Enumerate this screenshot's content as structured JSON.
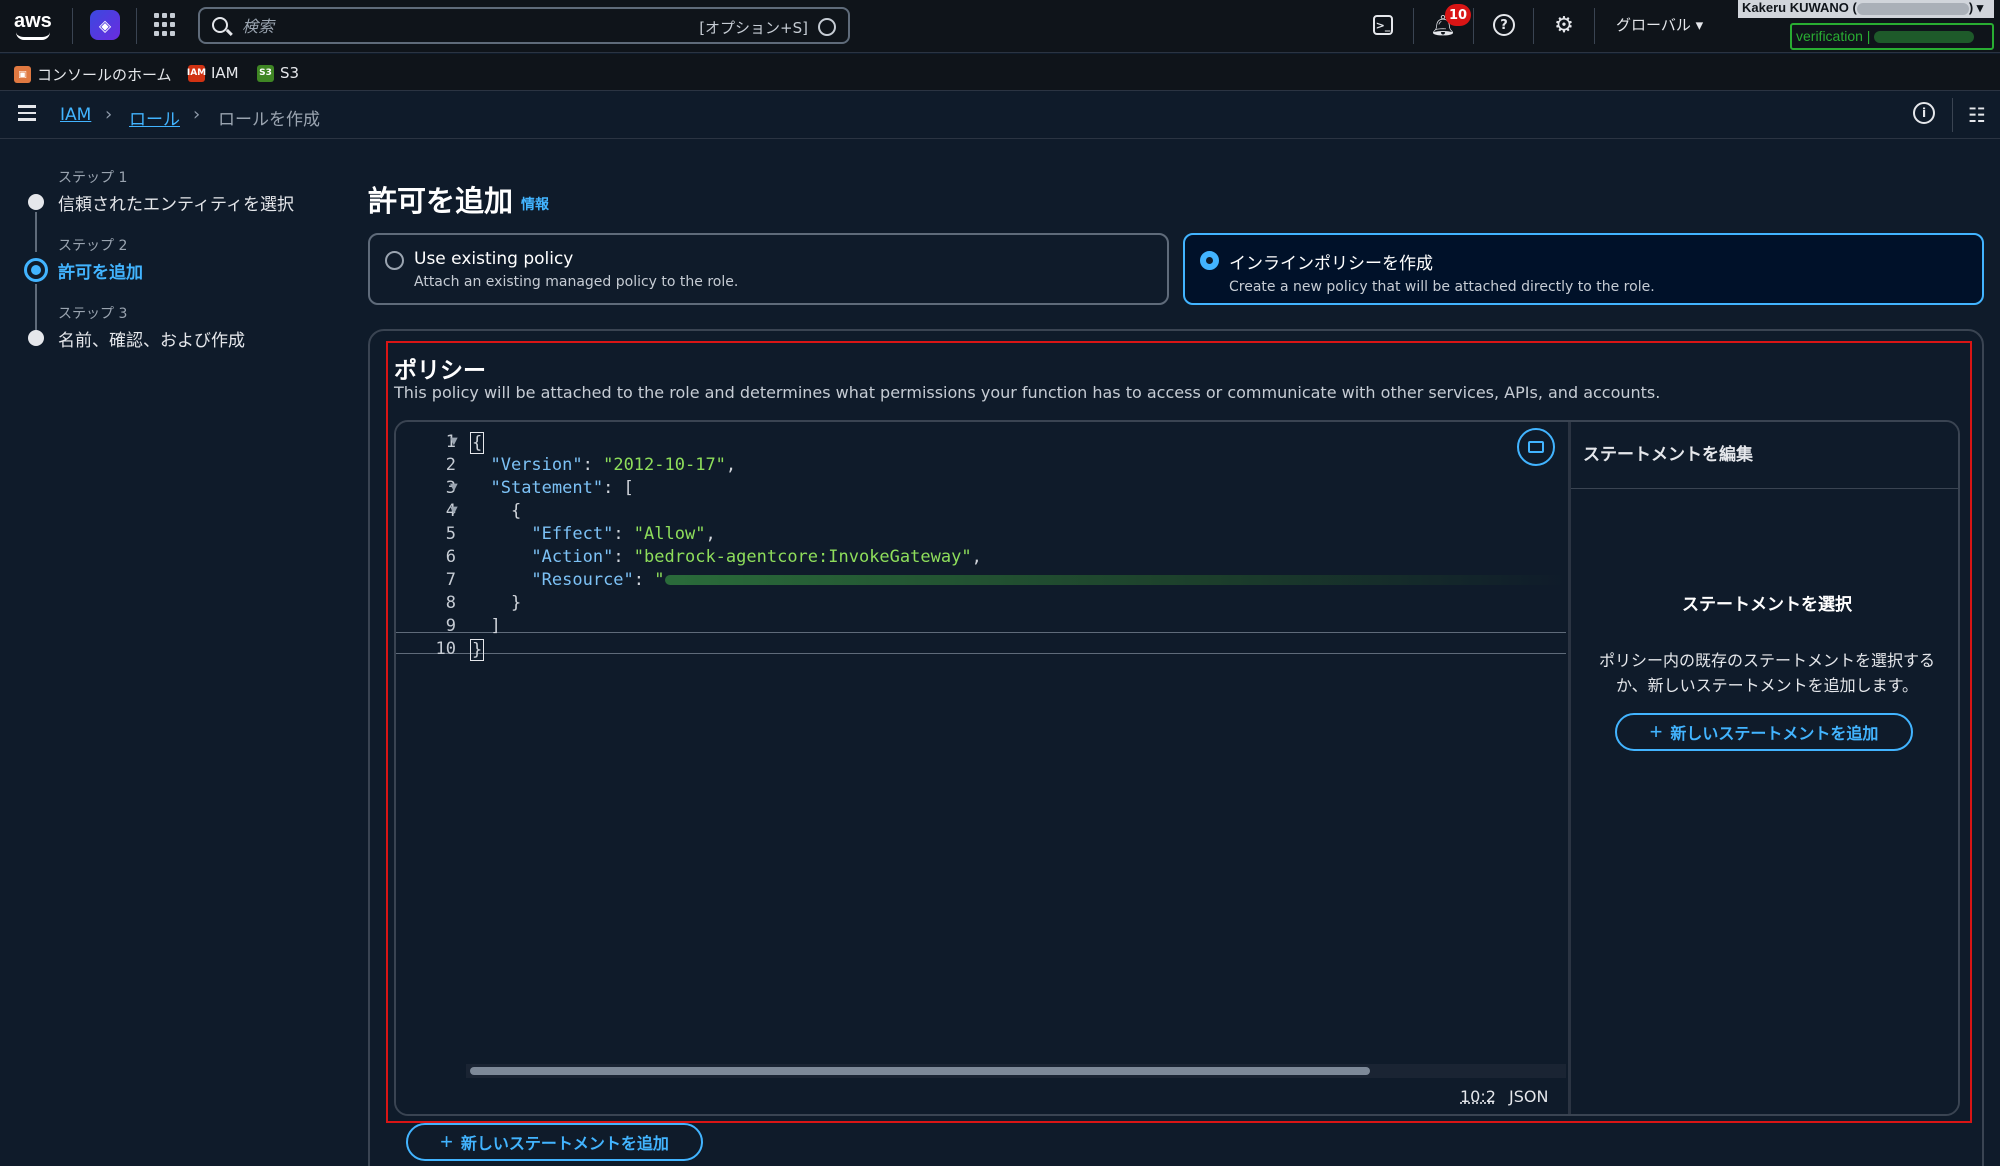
{
  "topnav": {
    "search_placeholder": "検索",
    "search_shortcut": "[オプション+S]",
    "notification_count": "10",
    "region": "グローバル ▾",
    "user": "Kakeru KUWANO (",
    "user_suffix": ") ▾",
    "verification": "verification |"
  },
  "favorites": [
    {
      "label": "コンソールのホーム",
      "color": "#e07941"
    },
    {
      "label": "IAM",
      "color": "#d13212"
    },
    {
      "label": "S3",
      "color": "#3f8624"
    }
  ],
  "breadcrumb": {
    "item1": "IAM",
    "item2": "ロール",
    "current": "ロールを作成"
  },
  "steps": [
    {
      "num": "ステップ 1",
      "title": "信頼されたエンティティを選択"
    },
    {
      "num": "ステップ 2",
      "title": "許可を追加"
    },
    {
      "num": "ステップ 3",
      "title": "名前、確認、および作成"
    }
  ],
  "main": {
    "title": "許可を追加",
    "info": "情報",
    "option1": {
      "title": "Use existing policy",
      "desc": "Attach an existing managed policy to the role."
    },
    "option2": {
      "title": "インラインポリシーを作成",
      "desc": "Create a new policy that will be attached directly to the role."
    },
    "policy_title": "ポリシー",
    "policy_desc": "This policy will be attached to the role and determines what permissions your function has to access or communicate with other services, APIs, and accounts."
  },
  "editor": {
    "line_numbers": [
      "1",
      "2",
      "3",
      "4",
      "5",
      "6",
      "7",
      "8",
      "9",
      "10"
    ],
    "status_position": "10:2",
    "status_language": "JSON",
    "version_key": "\"Version\"",
    "version_value": "\"2012-10-17\"",
    "statement_key": "\"Statement\"",
    "effect_key": "\"Effect\"",
    "effect_value": "\"Allow\"",
    "action_key": "\"Action\"",
    "action_value": "\"bedrock-agentcore:InvokeGateway\"",
    "resource_key": "\"Resource\"",
    "resource_value_prefix": "\""
  },
  "side_panel": {
    "header": "ステートメントを編集",
    "title": "ステートメントを選択",
    "text": "ポリシー内の既存のステートメントを選択するか、新しいステートメントを追加します。",
    "add_button": "新しいステートメントを追加"
  },
  "bottom": {
    "add_button": "新しいステートメントを追加"
  },
  "colors": {
    "accent": "#42b4ff",
    "highlight_frame": "#d91515",
    "json_key": "#7cc1f5",
    "json_string": "#8ede5b"
  }
}
